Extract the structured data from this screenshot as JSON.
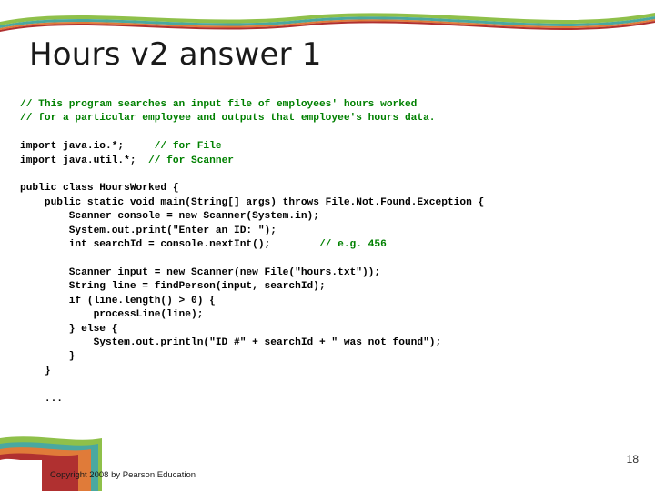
{
  "slide": {
    "title": "Hours v2 answer 1",
    "page_number": "18",
    "copyright": "Copyright 2008 by Pearson Education",
    "colors": {
      "comment": "#008000",
      "code": "#000000",
      "title": "#1a1a1a",
      "decor_green": "#8fc04a",
      "decor_teal": "#4aa8a0",
      "decor_orange": "#e07b39",
      "decor_red": "#b03030"
    }
  },
  "code": {
    "lines": [
      [
        {
          "t": "// This program searches an input file of employees' hours worked",
          "c": true
        }
      ],
      [
        {
          "t": "// for a particular employee and outputs that employee's hours data.",
          "c": true
        }
      ],
      [
        {
          "t": "",
          "c": false
        }
      ],
      [
        {
          "t": "import java.io.*;     ",
          "c": false
        },
        {
          "t": "// for File",
          "c": true
        }
      ],
      [
        {
          "t": "import java.util.*;  ",
          "c": false
        },
        {
          "t": "// for Scanner",
          "c": true
        }
      ],
      [
        {
          "t": "",
          "c": false
        }
      ],
      [
        {
          "t": "public class HoursWorked {",
          "c": false
        }
      ],
      [
        {
          "t": "    public static void main(String[] args) throws File.Not.Found.Exception {",
          "c": false
        }
      ],
      [
        {
          "t": "        Scanner console = new Scanner(System.in);",
          "c": false
        }
      ],
      [
        {
          "t": "        System.out.print(\"Enter an ID: \");",
          "c": false
        }
      ],
      [
        {
          "t": "        int searchId = console.nextInt();        ",
          "c": false
        },
        {
          "t": "// e.g. 456",
          "c": true
        }
      ],
      [
        {
          "t": "",
          "c": false
        }
      ],
      [
        {
          "t": "        Scanner input = new Scanner(new File(\"hours.txt\"));",
          "c": false
        }
      ],
      [
        {
          "t": "        String line = findPerson(input, searchId);",
          "c": false
        }
      ],
      [
        {
          "t": "        if (line.length() > 0) {",
          "c": false
        }
      ],
      [
        {
          "t": "            processLine(line);",
          "c": false
        }
      ],
      [
        {
          "t": "        } else {",
          "c": false
        }
      ],
      [
        {
          "t": "            System.out.println(\"ID #\" + searchId + \" was not found\");",
          "c": false
        }
      ],
      [
        {
          "t": "        }",
          "c": false
        }
      ],
      [
        {
          "t": "    }",
          "c": false
        }
      ],
      [
        {
          "t": "",
          "c": false
        }
      ],
      [
        {
          "t": "    ...",
          "c": false
        }
      ]
    ]
  }
}
